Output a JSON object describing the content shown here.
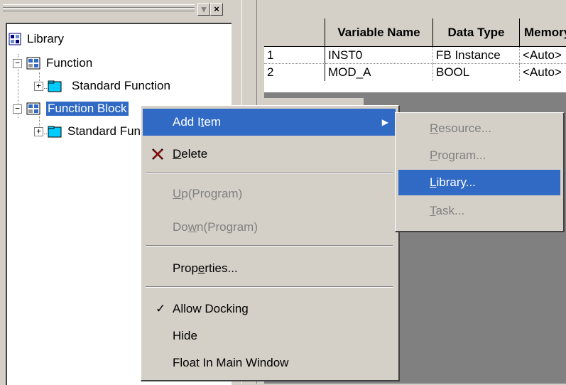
{
  "tree": {
    "root": "Library",
    "function": "Function",
    "standard_function": "Standard Function",
    "function_block": "Function Block",
    "standard_fb": "Standard Function Blocks"
  },
  "grid": {
    "headers": [
      "",
      "Variable Name",
      "Data Type",
      "Memory"
    ],
    "rows": [
      {
        "num": "1",
        "name": "INST0",
        "type": "FB Instance",
        "mem": "<Auto>"
      },
      {
        "num": "2",
        "name": "MOD_A",
        "type": "BOOL",
        "mem": "<Auto>"
      }
    ]
  },
  "context_menu": {
    "add_item": {
      "pre": "Add I",
      "ul": "t",
      "post": "em"
    },
    "delete": {
      "pre": "",
      "ul": "D",
      "post": "elete"
    },
    "up": {
      "pre": "",
      "ul": "U",
      "post": "p(Program)"
    },
    "down": {
      "pre": "Do",
      "ul": "w",
      "post": "n(Program)"
    },
    "properties": {
      "pre": "Prop",
      "ul": "e",
      "post": "rties..."
    },
    "allow_docking": "Allow Docking",
    "check_mark": "✓",
    "hide": "Hide",
    "float": "Float In Main Window"
  },
  "submenu": {
    "resource": {
      "pre": "",
      "ul": "R",
      "post": "esource..."
    },
    "program": {
      "pre": "",
      "ul": "P",
      "post": "rogram..."
    },
    "library": {
      "pre": "",
      "ul": "L",
      "post": "ibrary..."
    },
    "task": {
      "pre": "",
      "ul": "T",
      "post": "ask..."
    }
  },
  "colors": {
    "highlight": "#316ac5",
    "face": "#d4d0c8",
    "workspace": "#808080"
  },
  "icons": [
    "library-icon",
    "function-icon",
    "folder-icon",
    "delete-x-icon",
    "submenu-arrow-icon",
    "checkmark-icon"
  ]
}
